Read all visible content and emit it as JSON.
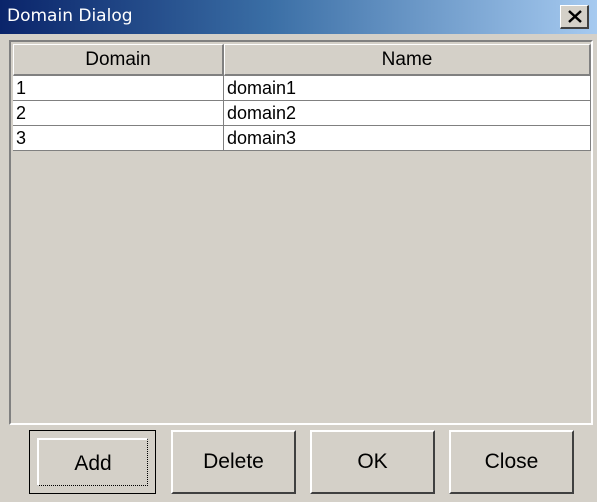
{
  "window": {
    "title": "Domain Dialog"
  },
  "table": {
    "columns": [
      "Domain",
      "Name"
    ],
    "rows": [
      {
        "domain": "1",
        "name": "domain1"
      },
      {
        "domain": "2",
        "name": "domain2"
      },
      {
        "domain": "3",
        "name": "domain3"
      }
    ]
  },
  "buttons": {
    "add": "Add",
    "delete": "Delete",
    "ok": "OK",
    "close": "Close"
  },
  "icons": {
    "close": "close-icon"
  },
  "colors": {
    "face": "#d4d0c8",
    "title_start": "#0a246a",
    "title_end": "#a6caf0",
    "title_text": "#ffffff",
    "cell_bg": "#ffffff"
  }
}
